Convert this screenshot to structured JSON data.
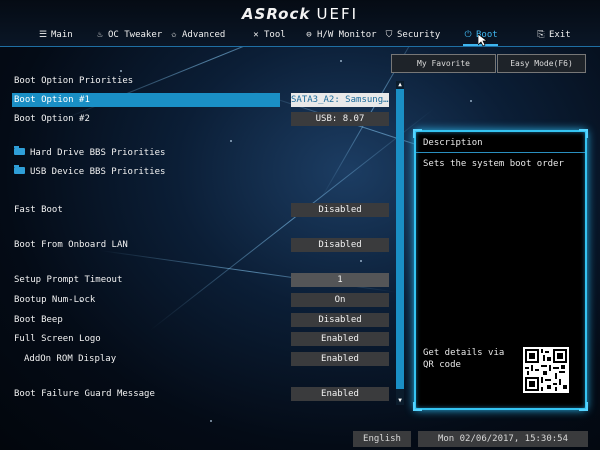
{
  "brand": {
    "logo": "ASRock",
    "product": "UEFI"
  },
  "nav": {
    "tabs": [
      {
        "icon": "list-icon",
        "label": "Main"
      },
      {
        "icon": "flame-icon",
        "label": "OC Tweaker"
      },
      {
        "icon": "star-icon",
        "label": "Advanced"
      },
      {
        "icon": "tools-icon",
        "label": "Tool"
      },
      {
        "icon": "monitor-icon",
        "label": "H/W Monitor"
      },
      {
        "icon": "shield-icon",
        "label": "Security"
      },
      {
        "icon": "power-icon",
        "label": "Boot"
      },
      {
        "icon": "exit-icon",
        "label": "Exit"
      }
    ],
    "active": "Boot"
  },
  "buttons": {
    "favorite": "My Favorite",
    "easy_mode": "Easy Mode(F6)"
  },
  "settings": {
    "section_header": "Boot Option Priorities",
    "boot1": {
      "label": "Boot Option #1",
      "value": "SATA3_A2: Samsung..."
    },
    "boot2": {
      "label": "Boot Option #2",
      "value": "USB: 8.07"
    },
    "hdd_bbs": "Hard Drive BBS Priorities",
    "usb_bbs": "USB Device BBS Priorities",
    "fast_boot": {
      "label": "Fast Boot",
      "value": "Disabled"
    },
    "onboard_lan": {
      "label": "Boot From Onboard LAN",
      "value": "Disabled"
    },
    "setup_timeout": {
      "label": "Setup Prompt Timeout",
      "value": "1"
    },
    "numlock": {
      "label": "Bootup Num-Lock",
      "value": "On"
    },
    "beep": {
      "label": "Boot Beep",
      "value": "Disabled"
    },
    "full_logo": {
      "label": "Full Screen Logo",
      "value": "Enabled"
    },
    "addon_rom": {
      "label": "AddOn ROM Display",
      "value": "Enabled"
    },
    "guard_msg": {
      "label": "Boot Failure Guard Message",
      "value": "Enabled"
    }
  },
  "description": {
    "title": "Description",
    "text": "Sets the system boot order",
    "qr_text": "Get details via QR code"
  },
  "footer": {
    "language": "English",
    "datetime": "Mon 02/06/2017, 15:30:54"
  },
  "colors": {
    "accent": "#1a8fc5",
    "active_tab": "#3fb6ef",
    "glow": "#35c4f2"
  }
}
